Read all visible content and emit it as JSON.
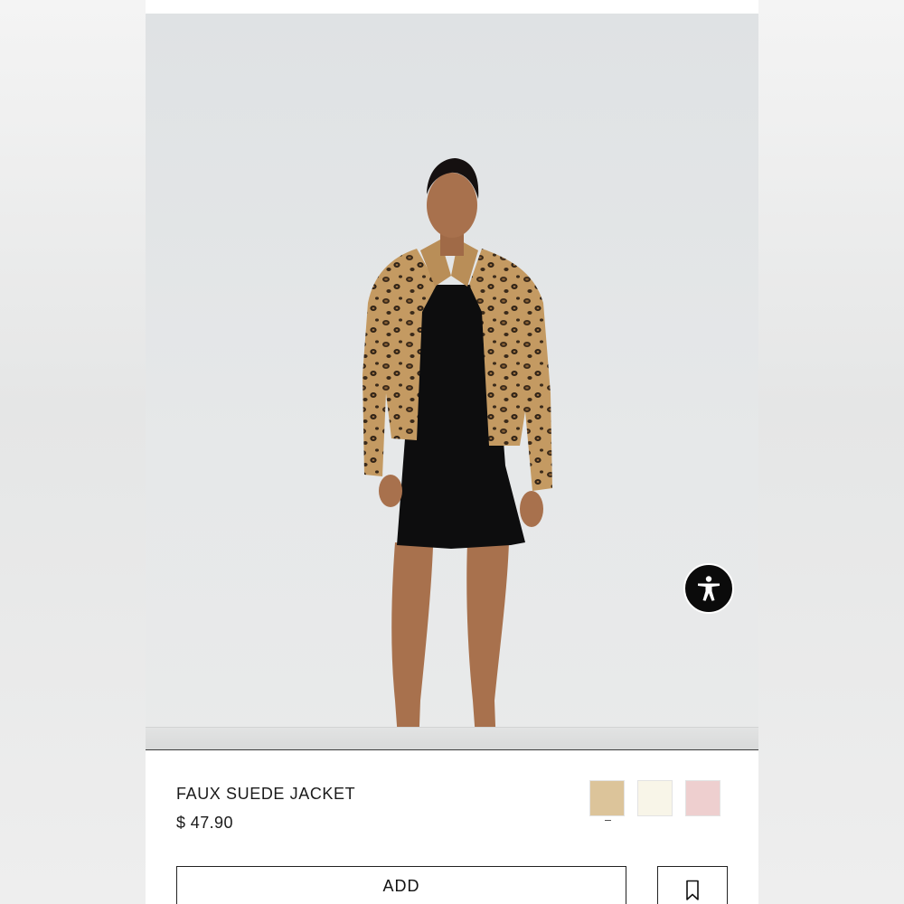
{
  "product": {
    "title": "FAUX SUEDE JACKET",
    "price": "$ 47.90"
  },
  "colors": {
    "swatches": [
      {
        "name": "camel",
        "hex": "#dcc49a",
        "selected": true
      },
      {
        "name": "cream",
        "hex": "#f8f5e8",
        "selected": false
      },
      {
        "name": "pink",
        "hex": "#eecfcf",
        "selected": false
      }
    ]
  },
  "actions": {
    "add_label": "ADD"
  },
  "icons": {
    "accessibility": "accessibility-icon",
    "bookmark": "bookmark-icon"
  }
}
